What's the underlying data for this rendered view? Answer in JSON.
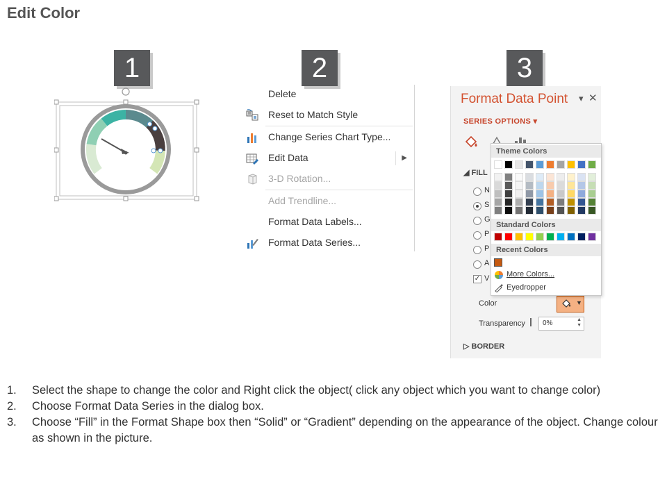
{
  "page": {
    "title": "Edit Color"
  },
  "steps": [
    "1",
    "2",
    "3"
  ],
  "context_menu": {
    "items": [
      {
        "label": "Delete",
        "disabled": false,
        "icon": ""
      },
      {
        "label": "Reset to Match Style",
        "disabled": false,
        "icon": "reset-style-icon"
      },
      {
        "label": "Change Series Chart Type...",
        "disabled": false,
        "icon": "bar-chart-icon"
      },
      {
        "label": "Edit Data",
        "disabled": false,
        "icon": "edit-data-icon",
        "submenu": true
      },
      {
        "label": "3-D Rotation...",
        "disabled": true,
        "icon": "cube-icon"
      },
      {
        "label": "Add Trendline...",
        "disabled": true,
        "icon": ""
      },
      {
        "label": "Format Data Labels...",
        "disabled": false,
        "icon": ""
      },
      {
        "label": "Format Data Series...",
        "disabled": false,
        "icon": "format-series-icon"
      }
    ]
  },
  "format_pane": {
    "title": "Format Data Point",
    "series_options": "SERIES OPTIONS",
    "fill_header": "FILL",
    "radio_letters": [
      "N",
      "S",
      "G",
      "P",
      "P",
      "A"
    ],
    "checkbox_letter": "V",
    "color_label": "Color",
    "transparency_label": "Transparency",
    "transparency_value": "0%",
    "border_header": "BORDER",
    "palette": {
      "theme_header": "Theme Colors",
      "standard_header": "Standard Colors",
      "recent_header": "Recent Colors",
      "more_colors": "More Colors...",
      "eyedropper": "Eyedropper",
      "theme_colors": [
        "#ffffff",
        "#000000",
        "#e7e6e6",
        "#44546a",
        "#5b9bd5",
        "#ed7d31",
        "#a5a5a5",
        "#ffc000",
        "#4472c4",
        "#70ad47"
      ],
      "standard_colors": [
        "#c00000",
        "#ff0000",
        "#ffc000",
        "#ffff00",
        "#92d050",
        "#00b050",
        "#00b0f0",
        "#0070c0",
        "#002060",
        "#7030a0"
      ],
      "recent_colors": [
        "#c55a11"
      ]
    }
  },
  "instructions": [
    {
      "num": "1.",
      "text": "Select the shape to change the color and Right click the object( click any object which you want to change color)"
    },
    {
      "num": "2.",
      "text": "Choose Format Data Series in the dialog box."
    },
    {
      "num": "3.",
      "text": "Choose “Fill” in the Format Shape box then “Solid” or “Gradient” depending on the appearance of the object. Change colour as shown in the picture."
    }
  ]
}
